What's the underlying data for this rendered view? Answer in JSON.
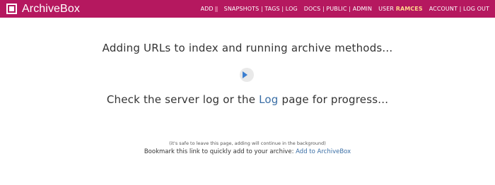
{
  "header": {
    "brand": "ArchiveBox",
    "nav": {
      "add": "ADD",
      "snapshots": "SNAPSHOTS",
      "tags": "TAGS",
      "log": "LOG",
      "docs": "DOCS",
      "public": "PUBLIC",
      "admin": "ADMIN",
      "user_prefix": "USER",
      "username": "RAMCES",
      "account": "ACCOUNT",
      "logout": "LOG OUT",
      "separator": "|"
    }
  },
  "main": {
    "heading": "Adding URLs to index and running archive methods...",
    "progress_prefix": "Check the server log or the",
    "progress_link": "Log",
    "progress_suffix": "page for progress...",
    "note": "(it's safe to leave this page, adding will continue in the background)",
    "bookmark_text": "Bookmark this link to quickly add to your archive:",
    "bookmark_link": "Add to ArchiveBox"
  },
  "colors": {
    "header_bg": "#b5185f",
    "link": "#3a6ea5",
    "username": "#ffd58a",
    "spinner": "#3c7fd0"
  }
}
